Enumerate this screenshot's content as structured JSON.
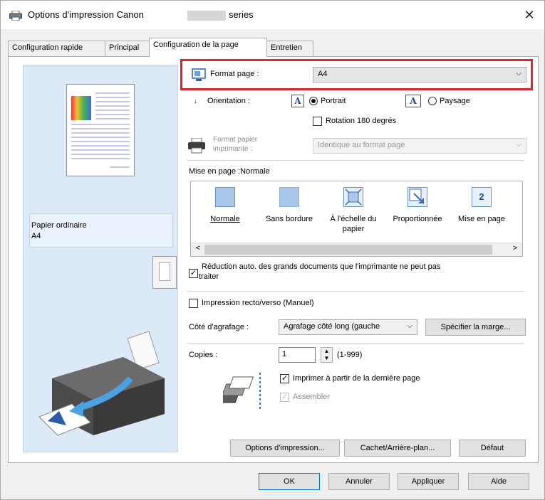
{
  "window": {
    "title": "Options d'impression Canon",
    "title_suffix": "series",
    "close_label": "✕"
  },
  "tabs": [
    {
      "label": "Configuration rapide"
    },
    {
      "label": "Principal"
    },
    {
      "label": "Configuration de la page",
      "active": true
    },
    {
      "label": "Entretien"
    }
  ],
  "preview": {
    "paper_type": "Papier ordinaire",
    "paper_size": "A4"
  },
  "page_setup": {
    "format_label": "Format page :",
    "format_value": "A4",
    "orientation_label": "Orientation :",
    "portrait_label": "Portrait",
    "portrait_selected": true,
    "landscape_label": "Paysage",
    "rotation_label": "Rotation 180 degrés",
    "rotation_checked": false,
    "printer_paper_label_1": "Format papier",
    "printer_paper_label_2": "imprimante :",
    "printer_paper_value": "Identique au format page",
    "layout_label": "Mise en page :Normale",
    "layouts": [
      {
        "label": "Normale",
        "selected": true
      },
      {
        "label": "Sans bordure"
      },
      {
        "label": "À l'échelle du papier"
      },
      {
        "label": "Proportionnée"
      },
      {
        "label": "Mise en page"
      }
    ],
    "layout_badge": "2",
    "auto_reduce_label_1": "Réduction auto. des grands documents que l'imprimante ne peut pas",
    "auto_reduce_label_2": "traiter",
    "auto_reduce_checked": true,
    "duplex_label": "Impression recto/verso (Manuel)",
    "duplex_checked": false,
    "stapling_label": "Côté d'agrafage :",
    "stapling_value": "Agrafage côté long (gauche",
    "margin_button": "Spécifier la marge...",
    "copies_label": "Copies :",
    "copies_value": "1",
    "copies_range": "(1-999)",
    "reverse_label": "Imprimer à partir de la dernière page",
    "reverse_checked": true,
    "collate_label": "Assembler",
    "collate_checked": true
  },
  "panel_buttons": {
    "print_options": "Options d'impression...",
    "stamp": "Cachet/Arrière-plan...",
    "defaults": "Défaut"
  },
  "dialog_buttons": {
    "ok": "OK",
    "cancel": "Annuler",
    "apply": "Appliquer",
    "help": "Aide"
  },
  "colors": {
    "highlight": "#d9262e",
    "preview_bg": "#dce9f6",
    "layout_icon": "#a9c7ea"
  }
}
